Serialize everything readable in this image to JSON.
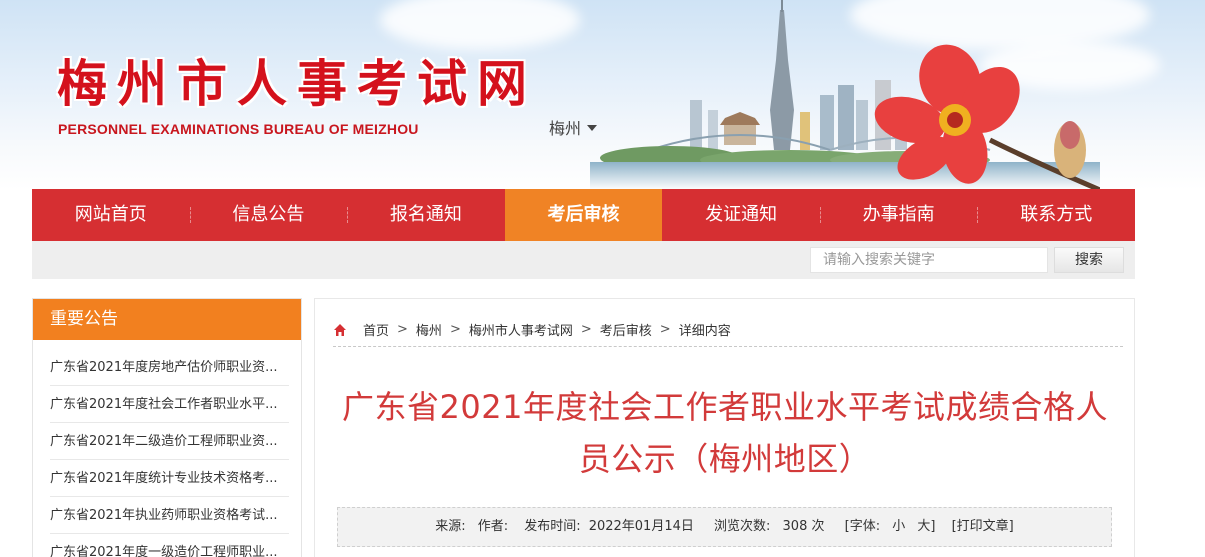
{
  "header": {
    "title": "梅州市人事考试网",
    "subtitle": "PERSONNEL EXAMINATIONS BUREAU OF MEIZHOU",
    "city_select": "梅州"
  },
  "nav": {
    "items": [
      {
        "label": "网站首页"
      },
      {
        "label": "信息公告"
      },
      {
        "label": "报名通知"
      },
      {
        "label": "考后审核",
        "active": true
      },
      {
        "label": "发证通知"
      },
      {
        "label": "办事指南"
      },
      {
        "label": "联系方式"
      }
    ]
  },
  "search": {
    "placeholder": "请输入搜索关键字",
    "button": "搜索"
  },
  "sidebar": {
    "title": "重要公告",
    "items": [
      "广东省2021年度房地产估价师职业资...",
      "广东省2021年度社会工作者职业水平...",
      "广东省2021年二级造价工程师职业资...",
      "广东省2021年度统计专业技术资格考...",
      "广东省2021年执业药师职业资格考试...",
      "广东省2021年度一级造价工程师职业..."
    ]
  },
  "breadcrumb": {
    "items": [
      "首页",
      "梅州",
      "梅州市人事考试网",
      "考后审核",
      "详细内容"
    ],
    "separator": ">"
  },
  "article": {
    "title": "广东省2021年度社会工作者职业水平考试成绩合格人员公示（梅州地区）",
    "meta": {
      "source_label": "来源:",
      "author_label": "作者:",
      "publish_label": "发布时间:",
      "publish_date": "2022年01月14日",
      "views_label": "浏览次数:",
      "views": "308 次",
      "font_label": "[字体:",
      "font_small": "小",
      "font_large": "大]",
      "print": "[打印文章]"
    }
  },
  "colors": {
    "brand_red": "#d62f32",
    "accent_orange": "#f08325",
    "title_red": "#d23a3a"
  }
}
